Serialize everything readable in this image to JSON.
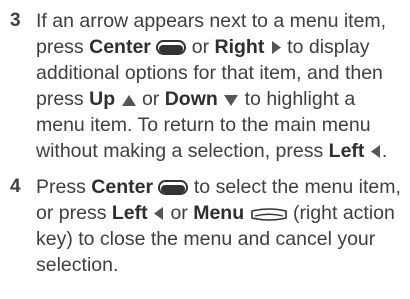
{
  "steps": [
    {
      "number": "3",
      "parts": {
        "a": "If an arrow appears next to a menu item, press ",
        "center": "Center",
        "b": " or ",
        "right": "Right",
        "c": " to display additional options for that item, and then press ",
        "up": "Up",
        "d": " or ",
        "down": "Down",
        "e": " to highlight a menu item. To return to the main menu without making a selection, press ",
        "left": "Left",
        "f": "."
      }
    },
    {
      "number": "4",
      "parts": {
        "a": "Press ",
        "center": "Center",
        "b": " to select the menu item, or press ",
        "left": "Left",
        "c": " or ",
        "menu": "Menu",
        "d": " (right action key) to close the menu and cancel your selection."
      }
    }
  ],
  "icons": {
    "center_key": "center-key-icon",
    "right_arrow": "right-arrow-icon",
    "up_arrow": "up-arrow-icon",
    "down_arrow": "down-arrow-icon",
    "left_arrow": "left-arrow-icon",
    "menu_key": "menu-key-icon"
  }
}
